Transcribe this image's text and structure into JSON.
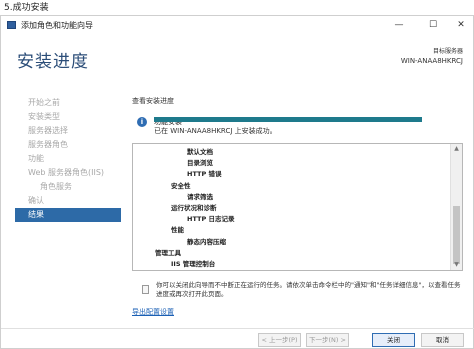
{
  "caption": "5.成功安装",
  "window": {
    "title": "添加角色和功能向导",
    "min": "—",
    "max": "☐",
    "close": "✕"
  },
  "header": {
    "title": "安装进度",
    "server_label": "目标服务器",
    "server_name": "WIN-ANAA8HKRCJ"
  },
  "sidebar": {
    "items": [
      {
        "label": "开始之前",
        "sub": false,
        "active": false
      },
      {
        "label": "安装类型",
        "sub": false,
        "active": false
      },
      {
        "label": "服务器选择",
        "sub": false,
        "active": false
      },
      {
        "label": "服务器角色",
        "sub": false,
        "active": false
      },
      {
        "label": "功能",
        "sub": false,
        "active": false
      },
      {
        "label": "Web 服务器角色(IIS)",
        "sub": false,
        "active": false
      },
      {
        "label": "角色服务",
        "sub": true,
        "active": false
      },
      {
        "label": "确认",
        "sub": false,
        "active": false
      },
      {
        "label": "结果",
        "sub": false,
        "active": true
      }
    ]
  },
  "main": {
    "section_label": "查看安装进度",
    "info_icon": "i",
    "info_text": "功能安装",
    "progress": 1.0,
    "success_text": "已在 WIN-ANAA8HKRCJ 上安装成功。",
    "list_items": [
      {
        "text": "默认文档",
        "indent": 2,
        "bold": true
      },
      {
        "text": "目录浏览",
        "indent": 2,
        "bold": true
      },
      {
        "text": "HTTP 错误",
        "indent": 2,
        "bold": true
      },
      {
        "text": "安全性",
        "indent": 1,
        "bold": true
      },
      {
        "text": "请求筛选",
        "indent": 2,
        "bold": true
      },
      {
        "text": "运行状况和诊断",
        "indent": 1,
        "bold": true
      },
      {
        "text": "HTTP 日志记录",
        "indent": 2,
        "bold": true
      },
      {
        "text": "性能",
        "indent": 1,
        "bold": true
      },
      {
        "text": "静态内容压缩",
        "indent": 2,
        "bold": true
      },
      {
        "text": "管理工具",
        "indent": 0,
        "bold": true
      },
      {
        "text": "IIS 管理控制台",
        "indent": 1,
        "bold": true
      }
    ],
    "scroll_up": "▲",
    "scroll_down": "▼",
    "note": "你可以关闭此向导而不中断正在运行的任务。请依次单击命令栏中的\"通知\"和\"任务详细信息\"，以查看任务进度或再次打开此页面。",
    "export_link": "导出配置设置"
  },
  "footer": {
    "prev": "< 上一步(P)",
    "next": "下一步(N) >",
    "close": "关闭",
    "cancel": "取消"
  }
}
